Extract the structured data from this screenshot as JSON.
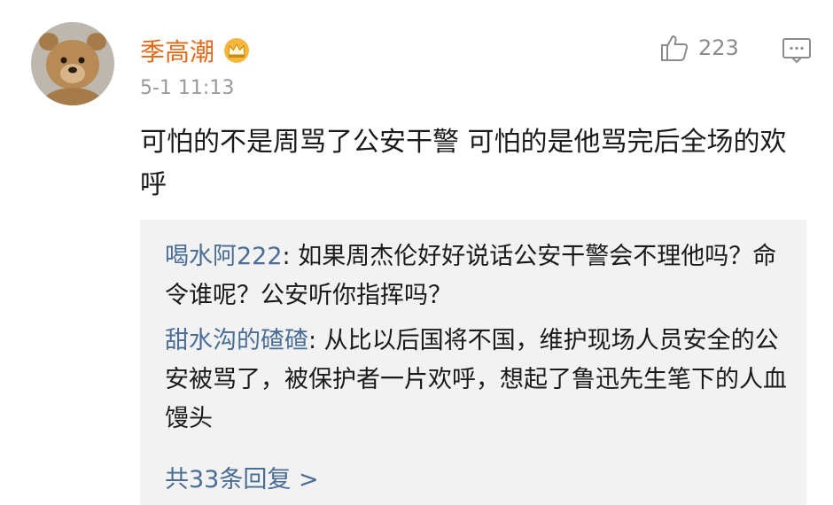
{
  "comment": {
    "username": "季高潮",
    "timestamp": "5-1 11:13",
    "like_count": "223",
    "text": "可怕的不是周骂了公安干警 可怕的是他骂完后全场的欢呼"
  },
  "replies": [
    {
      "author": "喝水阿222",
      "text": ": 如果周杰伦好好说话公安干警会不理他吗？命令谁呢？公安听你指挥吗？"
    },
    {
      "author": "甜水沟的碴碴",
      "text": ": 从比以后国将不国，维护现场人员安全的公安被骂了，被保护者一片欢呼，想起了鲁迅先生笔下的人血馒头"
    }
  ],
  "more_replies_label": "共33条回复 >",
  "colors": {
    "username": "#e06a1a",
    "link": "#4a6d95",
    "timestamp": "#9a9a9a",
    "reply_bg": "#f2f2f2"
  },
  "icons": {
    "vip": "crown-vip-icon",
    "like": "thumbs-up-icon",
    "reply": "comment-bubble-icon"
  }
}
